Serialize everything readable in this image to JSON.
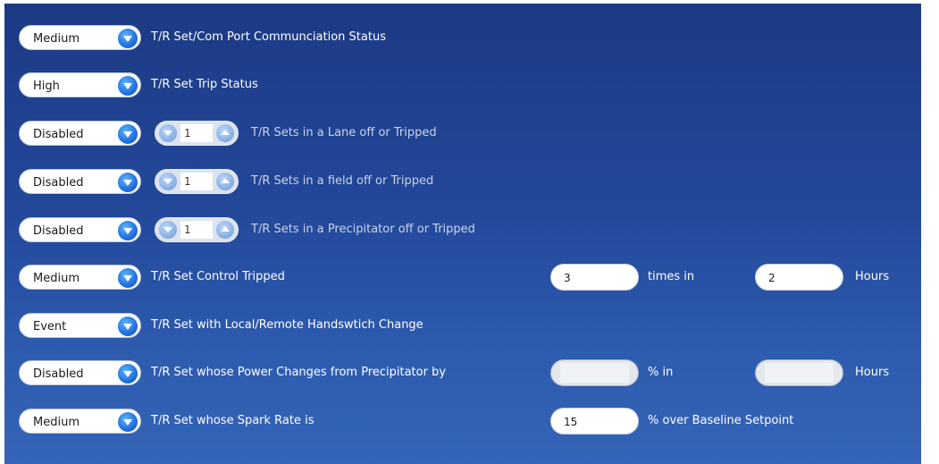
{
  "rows": [
    {
      "level": "Medium",
      "label": "T/R Set/Com Port Communciation Status"
    },
    {
      "level": "High",
      "label": "T/R Set Trip Status"
    },
    {
      "level": "Disabled",
      "count": "1",
      "label": "T/R Sets in a Lane off or Tripped"
    },
    {
      "level": "Disabled",
      "count": "1",
      "label": "T/R Sets in a field off or Tripped"
    },
    {
      "level": "Disabled",
      "count": "1",
      "label": "T/R Sets in a Precipitator off or Tripped"
    },
    {
      "level": "Medium",
      "label": "T/R Set Control Tripped",
      "value1": "3",
      "mid_label": "times in",
      "value2": "2",
      "end_label": "Hours"
    },
    {
      "level": "Event",
      "label": "T/R Set with Local/Remote Handswtich Change"
    },
    {
      "level": "Disabled",
      "label": "T/R Set whose Power Changes from Precipitator by",
      "value1": "",
      "mid_label": "% in",
      "value2": "",
      "end_label": "Hours"
    },
    {
      "level": "Medium",
      "label": "T/R Set whose Spark Rate is",
      "value1": "15",
      "mid_label": "% over Baseline Setpoint"
    }
  ],
  "colors": {
    "panel_top": "#1c3a84",
    "panel_bottom": "#3565b8",
    "dropdown_arrow": "#1f6fe0",
    "label_text": "#ffffff"
  },
  "icons": {
    "dropdown": "chevron-down-icon",
    "decrement": "decrement-icon",
    "increment": "increment-icon"
  }
}
